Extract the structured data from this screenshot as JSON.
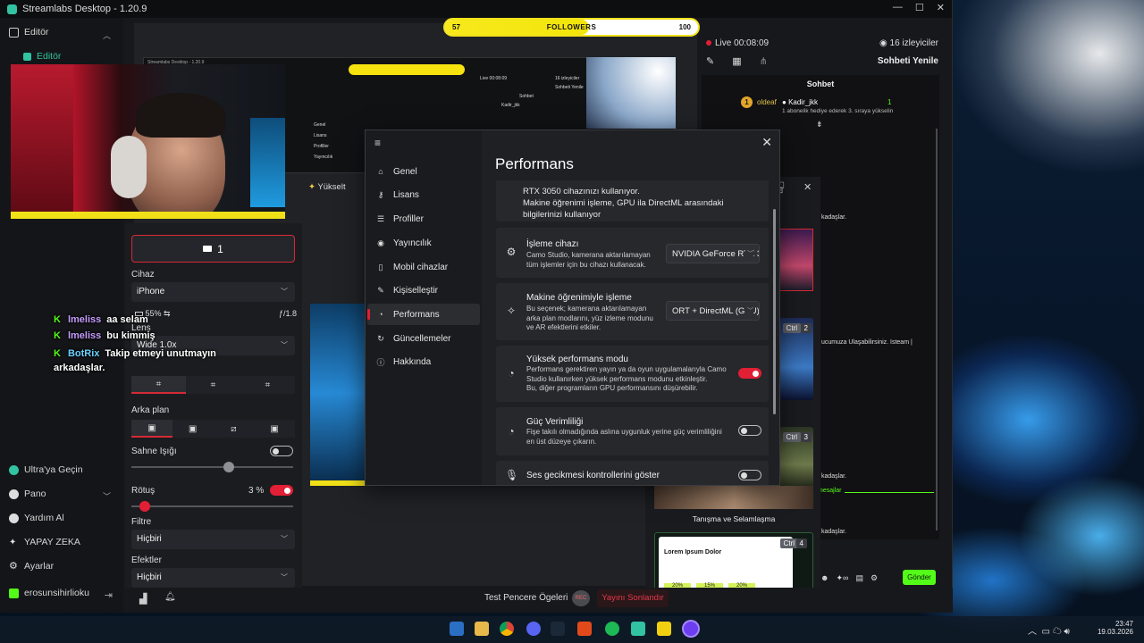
{
  "app": {
    "title": "Streamlabs Desktop - 1.20.9"
  },
  "sidebar": {
    "editor_group": "Editör",
    "editor_item": "Editör",
    "bottom_items": [
      {
        "label": "Ultra'ya Geçin",
        "icon": "ultra-icon"
      },
      {
        "label": "Pano",
        "icon": "dashboard-icon"
      },
      {
        "label": "Yardım Al",
        "icon": "help-icon"
      },
      {
        "label": "YAPAY ZEKA",
        "icon": "ai-sparkle-icon"
      },
      {
        "label": "Ayarlar",
        "icon": "settings-gear-icon"
      }
    ],
    "account": "erosunsihirlioku"
  },
  "followers_bar": {
    "left_value": "57",
    "label": "FOLLOWERS",
    "right_value": "100",
    "progress": 0.57
  },
  "nested_window": {
    "title": "Streamlabs Desktop - 1.20.9",
    "live": "Live 00:08:09",
    "viewers": "16 izleyiciler",
    "chat_refresh": "Sohbeti Yenile",
    "chat_title": "Sohbet",
    "user": "Kadir_jkk",
    "nav": [
      "Genel",
      "Lisans",
      "Profiller",
      "Yayıncılık"
    ]
  },
  "upgrade_label": "Yükselt",
  "camo_panel": {
    "camera_button": "1",
    "camera_label": "Cihaz",
    "camera_value": "iPhone",
    "battery": "55%",
    "aperture": "ƒ/1.8",
    "lens_label": "Lens",
    "lens_value": "Wide 1.0x",
    "background_label": "Arka plan",
    "stage_light_label": "Sahne Işığı",
    "retouch_label": "Rötuş",
    "retouch_value": "3 %",
    "retouch_fraction": 0.03,
    "stage_light_fraction": 0.6,
    "filter_label": "Filtre",
    "filter_value": "Hiçbiri",
    "effects_label": "Efektler",
    "effects_value": "Hiçbiri"
  },
  "overlay_chat": [
    {
      "user": "lmeliss",
      "msg": "aa selam"
    },
    {
      "user": "lmeliss",
      "msg": "bu kimmiş"
    },
    {
      "user": "BotRix",
      "msg": "Takip etmeyi unutmayın arkadaşlar."
    }
  ],
  "live_info": {
    "live_label": "Live",
    "live_time": "00:08:09",
    "viewers": "16 izleyiciler",
    "refresh": "Sohbeti Yenile"
  },
  "chat": {
    "title": "Sohbet",
    "rank": "1",
    "gifter": "oldeaf",
    "recipient": "Kadir_jkk",
    "gift_count": "1",
    "gift_msg": "1 abonelik hediye ederek 3. sıraya yükselin",
    "snippets": [
      "kadaşlar.",
      "ucumuza Ulaşabilirsiniz. Isteam |",
      "kadaşlar.",
      "mesajlar",
      "kadaşlar."
    ],
    "send_button": "Gönder"
  },
  "scenes": [
    {
      "ctrl": "Ctrl",
      "num": "2"
    },
    {
      "ctrl": "Ctrl",
      "num": "3",
      "caption": "Tanışma ve Selamlaşma"
    },
    {
      "ctrl": "Ctrl",
      "num": "4",
      "doc_title": "Lorem Ipsum Dolor",
      "stats": [
        "20%",
        "15%",
        "20%"
      ]
    }
  ],
  "modal": {
    "title": "Performans",
    "nav": [
      {
        "label": "Genel",
        "icon": "home-icon"
      },
      {
        "label": "Lisans",
        "icon": "key-icon"
      },
      {
        "label": "Profiller",
        "icon": "profiles-icon"
      },
      {
        "label": "Yayıncılık",
        "icon": "broadcast-icon"
      },
      {
        "label": "Mobil cihazlar",
        "icon": "mobile-icon"
      },
      {
        "label": "Kişiselleştir",
        "icon": "personalize-icon"
      },
      {
        "label": "Performans",
        "icon": "performance-icon",
        "active": true
      },
      {
        "label": "Güncellemeler",
        "icon": "update-icon"
      },
      {
        "label": "Hakkında",
        "icon": "info-icon"
      }
    ],
    "top_text": [
      "RTX 3050 cihazınızı kullanıyor.",
      "Makine öğrenimi işleme, GPU ila DirectML arasındaki",
      "bilgilerinizi kullanıyor"
    ],
    "cards": [
      {
        "title": "İşleme cihazı",
        "desc": [
          "Camo Studio, kamerana aktarılamayan",
          "tüm işlemler için bu cihazı kullanacak."
        ],
        "control": "dropdown",
        "value": "NVIDIA GeForce RTX 3050"
      },
      {
        "title": "Makine öğrenimiyle işleme",
        "desc": [
          "Bu seçenek; kamerana aktarılamayan",
          "arka plan modlarını, yüz izleme modunu",
          "ve AR efektlerini etkiler."
        ],
        "control": "dropdown",
        "value": "ORT + DirectML (GPU)"
      },
      {
        "title": "Yüksek performans modu",
        "desc": [
          "Performans gerektiren yayın ya da oyun uygulamalarıyla Camo",
          "Studio kullanırken yüksek performans modunu etkinleştir.",
          "Bu, diğer programların GPU performansını düşürebilir."
        ],
        "control": "toggle",
        "on": true
      },
      {
        "title": "Güç Verimliliği",
        "desc": [
          "Fişe takılı olmadığında aslına uygunluk yerine güç verimliliğini",
          "en üst düzeye çıkarın."
        ],
        "control": "toggle",
        "on": false
      },
      {
        "title": "Ses gecikmesi kontrollerini göster",
        "desc": [],
        "control": "toggle",
        "on": false
      }
    ]
  },
  "bottombar": {
    "test_windows": "Test Pencere Ögeleri",
    "rec": "REC",
    "end_stream": "Yayını Sonlandır"
  },
  "taskbar": {
    "time": "23:47",
    "date": "19.03.2026"
  }
}
